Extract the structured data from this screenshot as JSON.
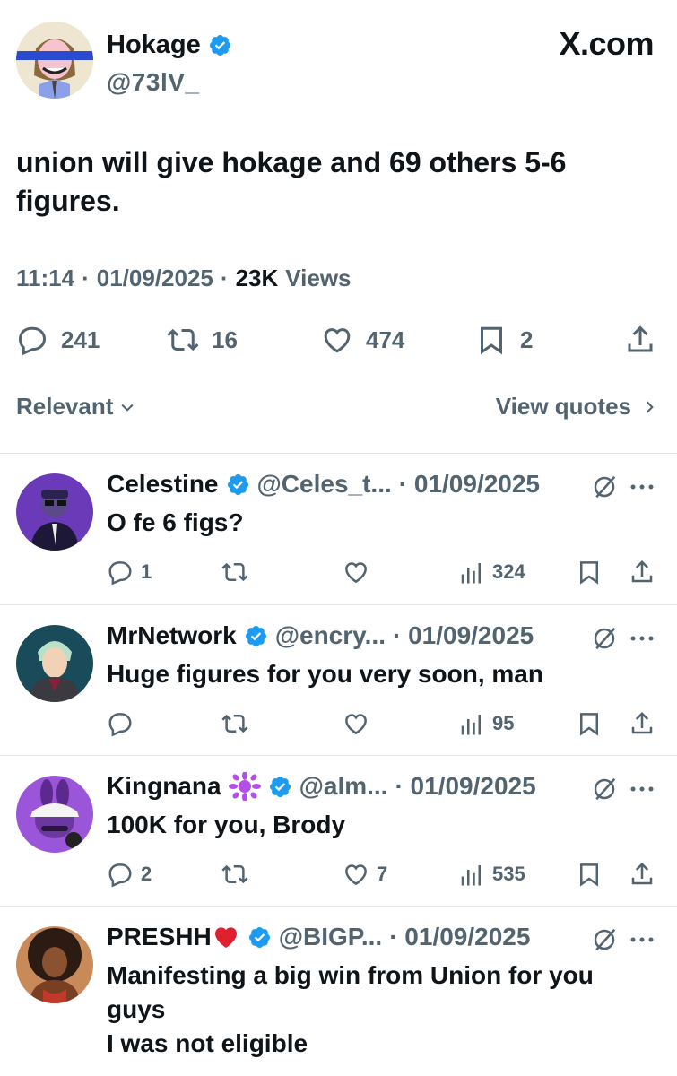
{
  "header": {
    "display_name": "Hokage",
    "handle": "@73lV_",
    "brand": "X.com"
  },
  "tweet": {
    "text": "union will give hokage and 69 others 5-6 figures.",
    "time": "11:14",
    "date": "01/09/2025",
    "views_count": "23K",
    "views_label": "Views",
    "replies": "241",
    "reposts": "16",
    "likes": "474",
    "bookmarks": "2"
  },
  "sort": {
    "label": "Relevant",
    "view_quotes": "View quotes"
  },
  "replies": [
    {
      "name": "Celestine",
      "handle": "@Celes_t...",
      "date": "· 01/09/2025",
      "text": "O fe 6 figs?",
      "reply_count": "1",
      "repost_count": "",
      "like_count": "",
      "views": "324"
    },
    {
      "name": "MrNetwork",
      "handle": "@encry...",
      "date": "· 01/09/2025",
      "text": "Huge figures for you very soon, man",
      "reply_count": "",
      "repost_count": "",
      "like_count": "",
      "views": "95"
    },
    {
      "name": "Kingnana",
      "handle": "@alm...",
      "date": "· 01/09/2025",
      "text": "100K for you, Brody",
      "reply_count": "2",
      "repost_count": "",
      "like_count": "7",
      "views": "535"
    },
    {
      "name": "PRESHH",
      "handle": "@BIGP...",
      "date": "· 01/09/2025",
      "text_lines": [
        "Manifesting a big win from Union for you",
        "guys",
        "I was not eligible"
      ]
    }
  ],
  "colors": {
    "verified": "#1d9bf0",
    "muted": "#536471",
    "text": "#0f1419",
    "heart_emoji": "#e0202e",
    "splash_emoji": "#b44ee8"
  }
}
